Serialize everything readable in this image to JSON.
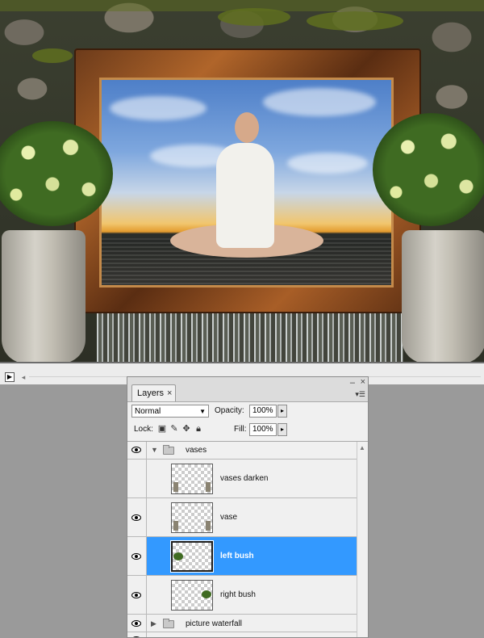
{
  "canvas": {
    "title": "composite artwork"
  },
  "statusbar": {
    "play_icon": "play-triangle-icon",
    "scroll_left_icon": "chevron-left-icon"
  },
  "panel": {
    "tab_label": "Layers",
    "tab_close": "×",
    "minimize": "–",
    "close": "×",
    "menu_icon": "▾☰",
    "blend_mode": "Normal",
    "opacity_label": "Opacity:",
    "opacity_value": "100%",
    "lock_label": "Lock:",
    "fill_label": "Fill:",
    "fill_value": "100%",
    "layers": [
      {
        "type": "group",
        "name": "vases",
        "expanded": true,
        "visible": true
      },
      {
        "type": "layer",
        "name": "vases darken",
        "visible": false,
        "selected": false
      },
      {
        "type": "layer",
        "name": "vase",
        "visible": true,
        "selected": false
      },
      {
        "type": "layer",
        "name": "left bush",
        "visible": true,
        "selected": true
      },
      {
        "type": "layer",
        "name": "right bush",
        "visible": true,
        "selected": false
      },
      {
        "type": "group",
        "name": "picture waterfall",
        "expanded": false,
        "visible": true
      }
    ],
    "selection_color": "#3399ff"
  }
}
